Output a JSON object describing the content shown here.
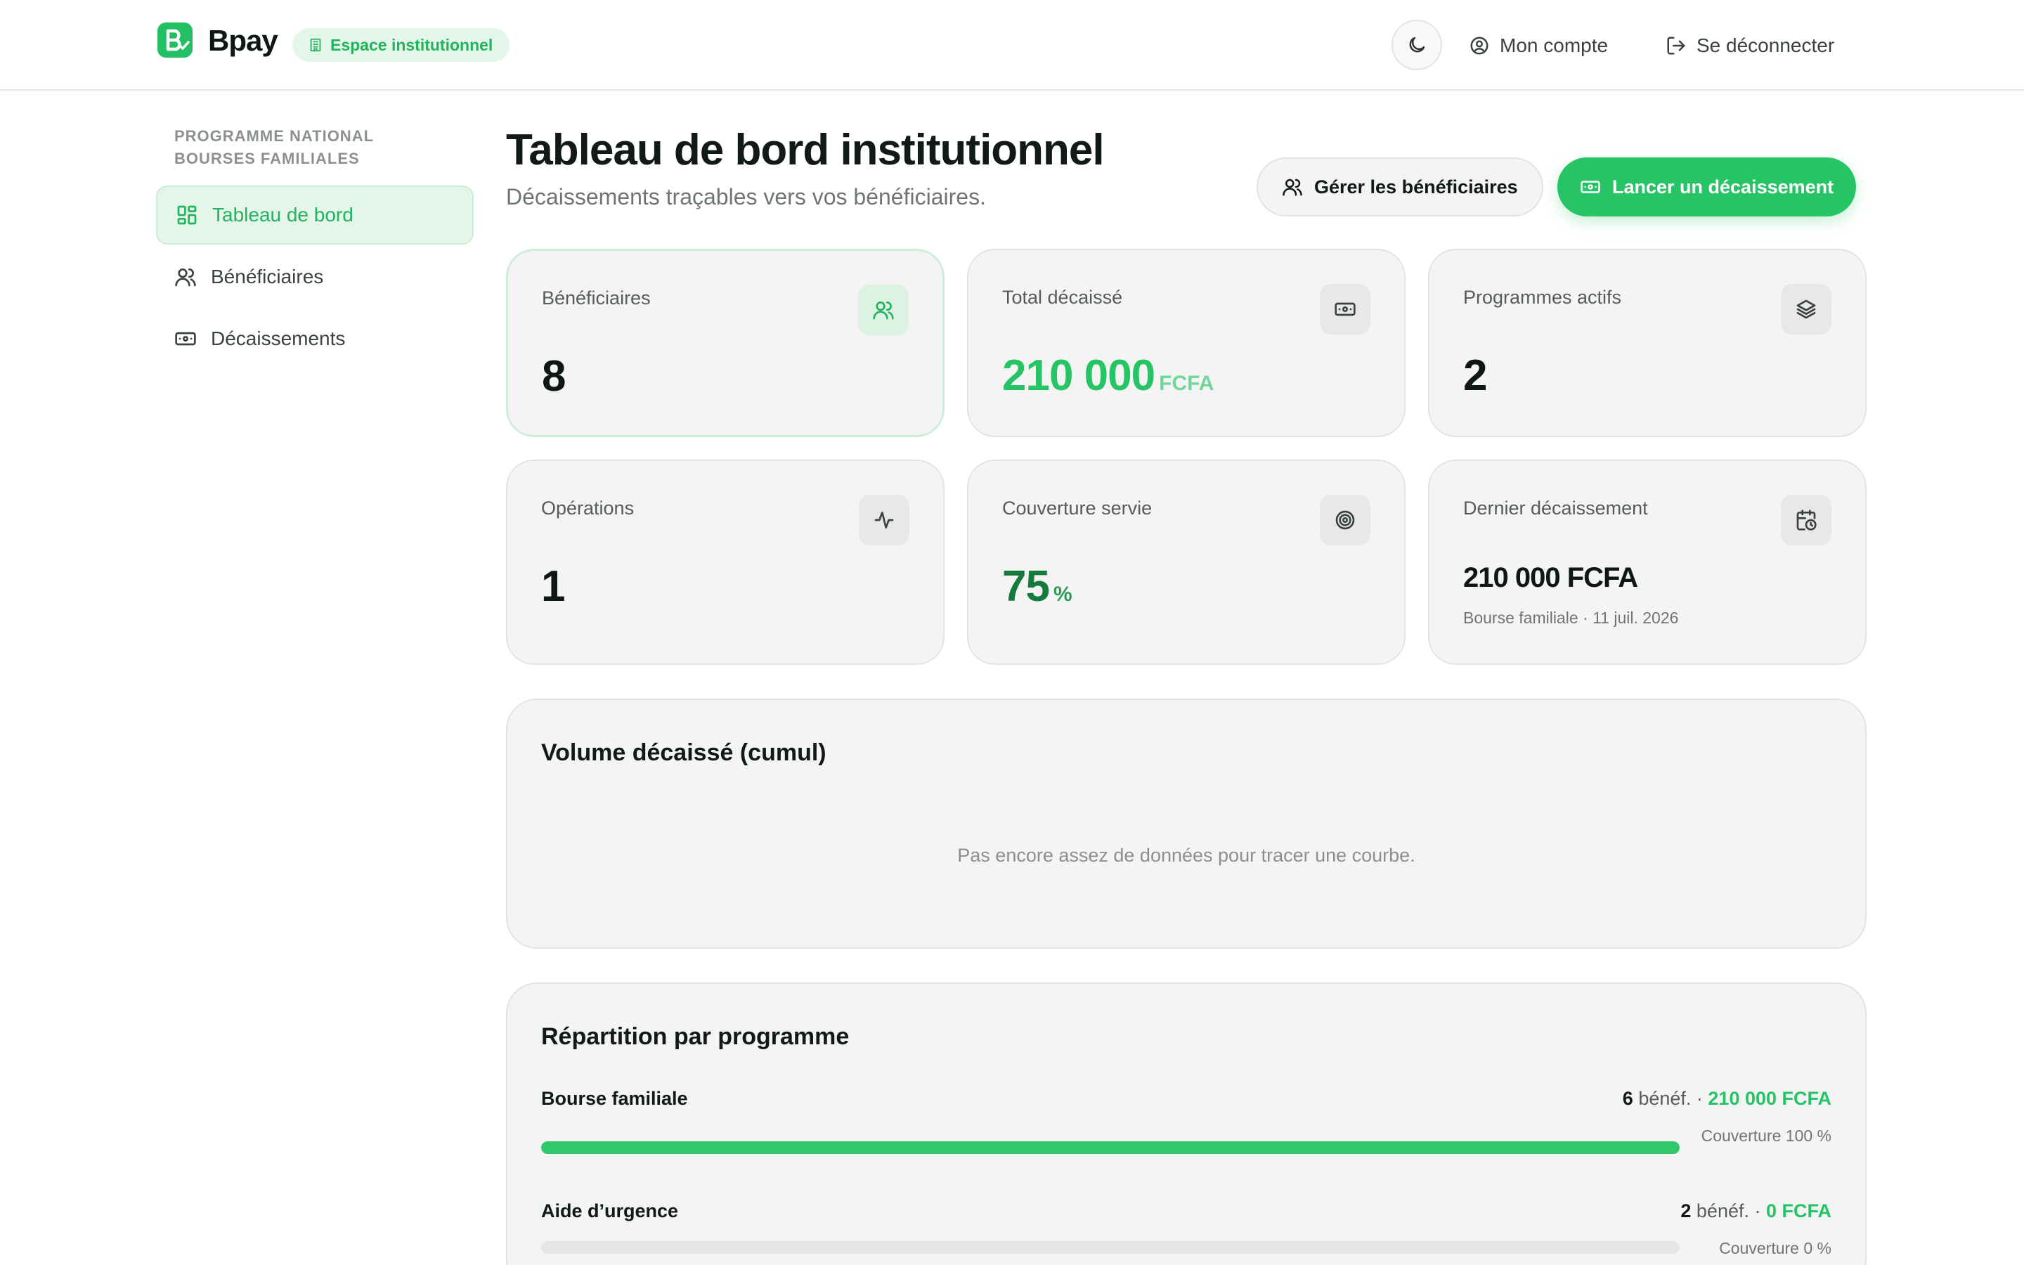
{
  "header": {
    "logo_text": "Bpay",
    "badge": "Espace institutionnel",
    "account": "Mon compte",
    "logout": "Se déconnecter"
  },
  "sidebar": {
    "heading": "PROGRAMME NATIONAL BOURSES FAMILIALES",
    "items": [
      {
        "label": "Tableau de bord",
        "active": true
      },
      {
        "label": "Bénéficiaires",
        "active": false
      },
      {
        "label": "Décaissements",
        "active": false
      }
    ]
  },
  "main": {
    "title": "Tableau de bord institutionnel",
    "subtitle": "Décaissements traçables vers vos bénéficiaires.",
    "manage_button": "Gérer les bénéficiaires",
    "launch_button": "Lancer un décaissement"
  },
  "stats": {
    "beneficiaries": {
      "label": "Bénéficiaires",
      "value": "8",
      "icon": "users-icon"
    },
    "total": {
      "label": "Total décaissé",
      "value": "210 000",
      "unit": "FCFA",
      "icon": "banknote-icon"
    },
    "programs": {
      "label": "Programmes actifs",
      "value": "2",
      "icon": "layers-icon"
    },
    "operations": {
      "label": "Opérations",
      "value": "1",
      "icon": "activity-icon"
    },
    "coverage": {
      "label": "Couverture servie",
      "value": "75",
      "unit": "%",
      "icon": "target-icon"
    },
    "last": {
      "label": "Dernier décaissement",
      "value": "210 000 FCFA",
      "meta": "Bourse familiale · 11 juil. 2026",
      "icon": "calendar-clock-icon"
    }
  },
  "volume_panel": {
    "title": "Volume décaissé (cumul)",
    "empty": "Pas encore assez de données pour tracer une courbe."
  },
  "repartition": {
    "title": "Répartition par programme",
    "programs": [
      {
        "name": "Bourse familiale",
        "count": "6",
        "benef_label": "bénéf. ·",
        "amount": "210 000 FCFA",
        "coverage_label": "Couverture 100 %",
        "coverage": 1.0
      },
      {
        "name": "Aide d’urgence",
        "count": "2",
        "benef_label": "bénéf. ·",
        "amount": "0 FCFA",
        "coverage_label": "Couverture 0 %",
        "coverage": 0.0
      }
    ]
  },
  "colors": {
    "accent": "#27c466",
    "accent_dark": "#157a3c",
    "accent_soft": "#e3f6e9"
  }
}
